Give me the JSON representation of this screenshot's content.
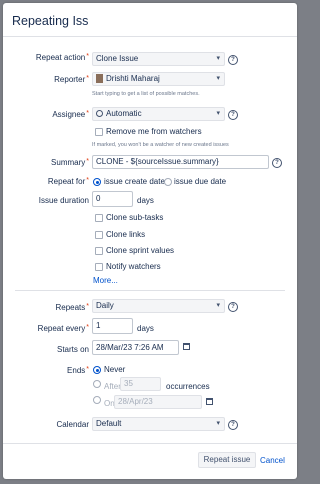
{
  "dialog": {
    "title": "Repeating Issue"
  },
  "repeat_action": {
    "label": "Repeat action",
    "value": "Clone Issue",
    "help": "?"
  },
  "reporter": {
    "label": "Reporter",
    "value": "Drishti Maharaj",
    "hint": "Start typing to get a list of possible matches."
  },
  "assignee": {
    "label": "Assignee",
    "value": "Automatic",
    "help": "?",
    "remove_label": "Remove me from watchers",
    "remove_hint": "If marked, you won't be a watcher of new created issues"
  },
  "summary": {
    "label": "Summary",
    "value": "CLONE - ${sourceIssue.summary}",
    "help": "?"
  },
  "repeat_for": {
    "label": "Repeat for",
    "opt1": "issue create date",
    "opt2": "issue due date"
  },
  "issue_duration": {
    "label": "Issue duration",
    "value": "0",
    "unit": "days"
  },
  "clone_options": [
    "Clone sub-tasks",
    "Clone links",
    "Clone sprint values",
    "Notify watchers"
  ],
  "more_link": "More...",
  "repeats": {
    "label": "Repeats",
    "value": "Daily",
    "help": "?"
  },
  "repeat_every": {
    "label": "Repeat every",
    "value": "1",
    "unit": "days"
  },
  "starts_on": {
    "label": "Starts on",
    "value": "28/Mar/23 7:26 AM"
  },
  "ends": {
    "label": "Ends",
    "never": "Never",
    "after_label": "After",
    "after_value": "35",
    "after_unit": "occurrences",
    "on_label": "On",
    "on_value": "28/Apr/23"
  },
  "calendar": {
    "label": "Calendar",
    "value": "Default",
    "help": "?"
  },
  "footer": {
    "submit": "Repeat issue",
    "cancel": "Cancel"
  },
  "colors": {
    "accent": "#0052cc",
    "required": "#de350b",
    "overlay": "#7c7f86"
  }
}
